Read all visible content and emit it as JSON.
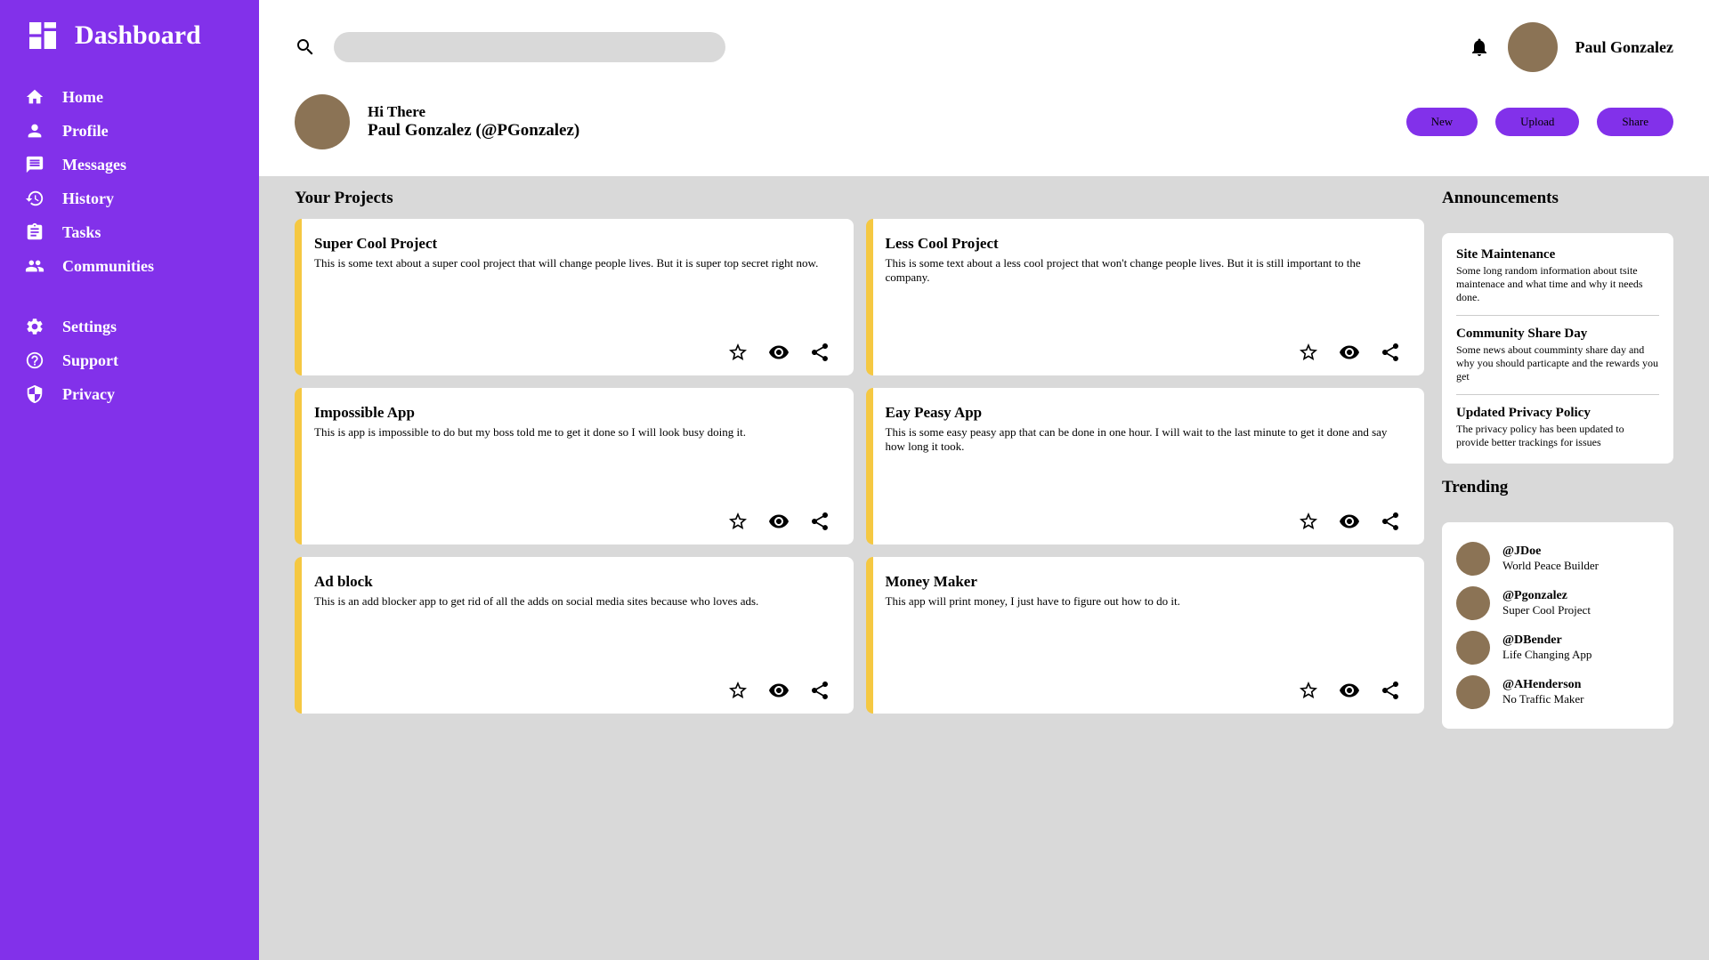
{
  "app_title": "Dashboard",
  "nav": {
    "main": [
      {
        "label": "Home",
        "icon": "home"
      },
      {
        "label": "Profile",
        "icon": "person"
      },
      {
        "label": "Messages",
        "icon": "message"
      },
      {
        "label": "History",
        "icon": "history"
      },
      {
        "label": "Tasks",
        "icon": "tasks"
      },
      {
        "label": "Communities",
        "icon": "communities"
      }
    ],
    "secondary": [
      {
        "label": "Settings",
        "icon": "settings"
      },
      {
        "label": "Support",
        "icon": "support"
      },
      {
        "label": "Privacy",
        "icon": "privacy"
      }
    ]
  },
  "header": {
    "user_name": "Paul Gonzalez"
  },
  "greeting": {
    "hi": "Hi There",
    "name_line": "Paul Gonzalez (@PGonzalez)"
  },
  "buttons": {
    "new": "New",
    "upload": "Upload",
    "share": "Share"
  },
  "sections": {
    "projects": "Your Projects",
    "announcements": "Announcements",
    "trending": "Trending"
  },
  "projects": [
    {
      "title": "Super Cool Project",
      "desc": "This is some text about a super cool project that will change people lives. But it is super top secret right now."
    },
    {
      "title": "Less Cool Project",
      "desc": "This is some text about a less cool project that won't change people lives. But it is still important to the company."
    },
    {
      "title": "Impossible App",
      "desc": "This is app is impossible to do but my boss told me to get it done so I will look busy doing it."
    },
    {
      "title": "Eay Peasy App",
      "desc": "This is some easy peasy app that can be done in one hour. I will wait to the last minute to get it done and say how long it took."
    },
    {
      "title": "Ad block",
      "desc": "This is an add blocker app to get rid of all the adds on social media sites because who loves ads."
    },
    {
      "title": "Money Maker",
      "desc": "This app will print money, I just have to figure out how to do it."
    }
  ],
  "announcements": [
    {
      "title": "Site Maintenance",
      "body": "Some long random information about tsite maintenace and what time and why it needs done."
    },
    {
      "title": "Community Share Day",
      "body": "Some news about coumminty share day and why you should particapte and the rewards you get"
    },
    {
      "title": "Updated Privacy Policy",
      "body": "The privacy policy has been updated to provide better trackings for issues"
    }
  ],
  "trending": [
    {
      "handle": "@JDoe",
      "project": "World Peace Builder"
    },
    {
      "handle": "@Pgonzalez",
      "project": "Super Cool Project"
    },
    {
      "handle": "@DBender",
      "project": "Life Changing App"
    },
    {
      "handle": "@AHenderson",
      "project": "No Traffic Maker"
    }
  ]
}
